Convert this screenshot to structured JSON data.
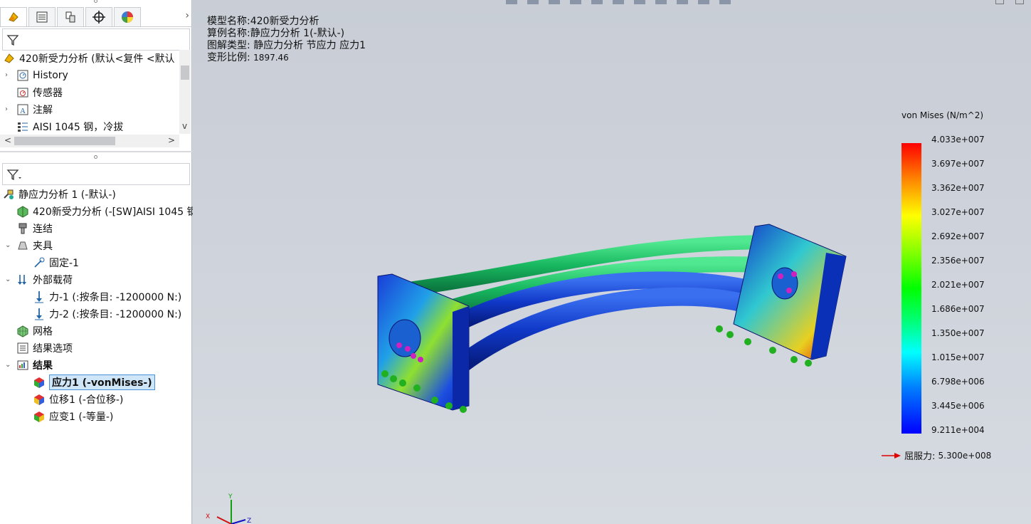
{
  "tabs": [
    {
      "icon": "feature-manager-icon",
      "active": true
    },
    {
      "icon": "property-manager-icon",
      "active": false
    },
    {
      "icon": "configuration-manager-icon",
      "active": false
    },
    {
      "icon": "dimxpert-icon",
      "active": false
    },
    {
      "icon": "display-manager-icon",
      "active": false
    }
  ],
  "feature_tree": {
    "part_name": "420新受力分析  (默认<复件 <默认",
    "items": [
      {
        "label": "History",
        "icon": "history-icon",
        "expandable": true
      },
      {
        "label": "传感器",
        "icon": "sensor-icon",
        "expandable": false
      },
      {
        "label": "注解",
        "icon": "annotation-icon",
        "expandable": true
      },
      {
        "label": "AISI 1045 钢，冷拔",
        "icon": "material-icon",
        "expandable": false
      }
    ]
  },
  "study_tree": {
    "study_name": "静应力分析 1 (-默认-)",
    "items": [
      {
        "label": "420新受力分析 (-[SW]AISI 1045 钢",
        "icon": "part-icon",
        "indent": 1,
        "expand": ""
      },
      {
        "label": "连结",
        "icon": "connections-icon",
        "indent": 1,
        "expand": ""
      },
      {
        "label": "夹具",
        "icon": "fixtures-icon",
        "indent": 1,
        "expand": "v"
      },
      {
        "label": "固定-1",
        "icon": "fixed-geometry-icon",
        "indent": 2,
        "expand": ""
      },
      {
        "label": "外部载荷",
        "icon": "external-loads-icon",
        "indent": 1,
        "expand": "v"
      },
      {
        "label": "力-1 (:按条目: -1200000 N:)",
        "icon": "force-arrow-icon",
        "indent": 2,
        "expand": ""
      },
      {
        "label": "力-2 (:按条目: -1200000 N:)",
        "icon": "force-arrow-icon",
        "indent": 2,
        "expand": ""
      },
      {
        "label": "网格",
        "icon": "mesh-icon",
        "indent": 1,
        "expand": ""
      },
      {
        "label": "结果选项",
        "icon": "result-options-icon",
        "indent": 1,
        "expand": ""
      },
      {
        "label": "结果",
        "icon": "results-folder-icon",
        "indent": 1,
        "expand": "v",
        "bold": true
      },
      {
        "label": "应力1 (-vonMises-)",
        "icon": "stress-plot-icon",
        "indent": 2,
        "expand": "",
        "selected": true
      },
      {
        "label": "位移1 (-合位移-)",
        "icon": "displacement-plot-icon",
        "indent": 2,
        "expand": ""
      },
      {
        "label": "应变1 (-等量-)",
        "icon": "strain-plot-icon",
        "indent": 2,
        "expand": ""
      }
    ]
  },
  "viewport": {
    "model_name_label": "模型名称:",
    "model_name": "420新受力分析",
    "study_label": "算例名称:",
    "study_name": "静应力分析 1(-默认-)",
    "plot_type_label": "图解类型:",
    "plot_type": "静应力分析 节应力 应力1",
    "deform_label": "变形比例:",
    "deform_scale": "1897.46"
  },
  "legend": {
    "title": "von Mises (N/m^2)",
    "ticks": [
      "4.033e+007",
      "3.697e+007",
      "3.362e+007",
      "3.027e+007",
      "2.692e+007",
      "2.356e+007",
      "2.021e+007",
      "1.686e+007",
      "1.350e+007",
      "1.015e+007",
      "6.798e+006",
      "3.445e+006",
      "9.211e+004"
    ],
    "yield_label": "屈服力:",
    "yield_value": "5.300e+008",
    "yield_arrow_color": "#e00000"
  },
  "triad": {
    "x": "X",
    "y": "Y",
    "z": "Z"
  }
}
